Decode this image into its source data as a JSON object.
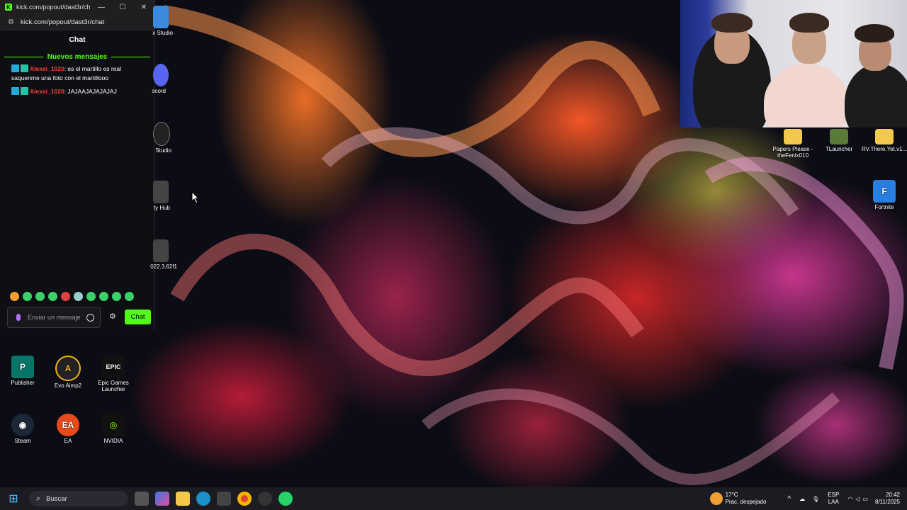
{
  "browser": {
    "title": "kick.com/popout/dast3r/ch...",
    "url": "kick.com/popout/dast3r/chat",
    "minimize_icon": "minimize-icon",
    "maximize_icon": "maximize-icon",
    "close_icon": "close-icon"
  },
  "chat": {
    "heading": "Chat",
    "new_messages_label": "Nuevos mensajes",
    "messages": [
      {
        "user": "Alexei_1020",
        "text": ": es el martillo es real saquenme una foto con el martillooo"
      },
      {
        "user": "Alexei_1020",
        "text": ": JAJAAJAJAJAJAJ"
      }
    ],
    "input_placeholder": "Enviar un mensaje",
    "send_label": "Chat",
    "accent_color": "#53fc18"
  },
  "desktop": {
    "icons_left_partial": [
      "x Studio",
      "scord",
      "Studio",
      "ty Hub",
      "022.3.62f1"
    ],
    "icons_bottom": [
      "Publisher",
      "Evo Aimp2",
      "Epic Games Launcher",
      "Steam",
      "EA",
      "NVIDIA"
    ],
    "icons_right": [
      "Papers Please - theFenix010",
      "TLauncher",
      "RV.There.Yet.v1...",
      "Fortnite"
    ]
  },
  "taskbar": {
    "search_placeholder": "Buscar",
    "weather_temp": "17°C",
    "weather_desc": "Prac. despejado",
    "lang_top": "ESP",
    "lang_bottom": "LAA",
    "time": "20:42",
    "date": "8/11/2025"
  }
}
